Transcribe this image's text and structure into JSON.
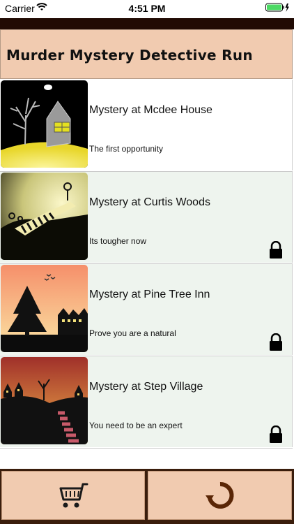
{
  "status_bar": {
    "carrier": "Carrier",
    "time": "4:51 PM"
  },
  "header": {
    "title": "Murder Mystery Detective Run"
  },
  "levels": [
    {
      "title": "Mystery at Mcdee House",
      "subtitle": "The first opportunity",
      "locked": false,
      "scene": "house"
    },
    {
      "title": "Mystery at Curtis Woods",
      "subtitle": "Its tougher now",
      "locked": true,
      "scene": "woods"
    },
    {
      "title": "Mystery at Pine Tree Inn",
      "subtitle": "Prove you are a natural",
      "locked": true,
      "scene": "inn"
    },
    {
      "title": "Mystery at Step Village",
      "subtitle": "You need to be an expert",
      "locked": true,
      "scene": "village"
    }
  ],
  "bottom_bar": {
    "left_icon": "shopping-cart-icon",
    "right_icon": "restart-icon"
  },
  "colors": {
    "header_bg": "#f1cbb0",
    "bar_dark": "#210b04",
    "row_alt_bg": "#eef4ee"
  }
}
